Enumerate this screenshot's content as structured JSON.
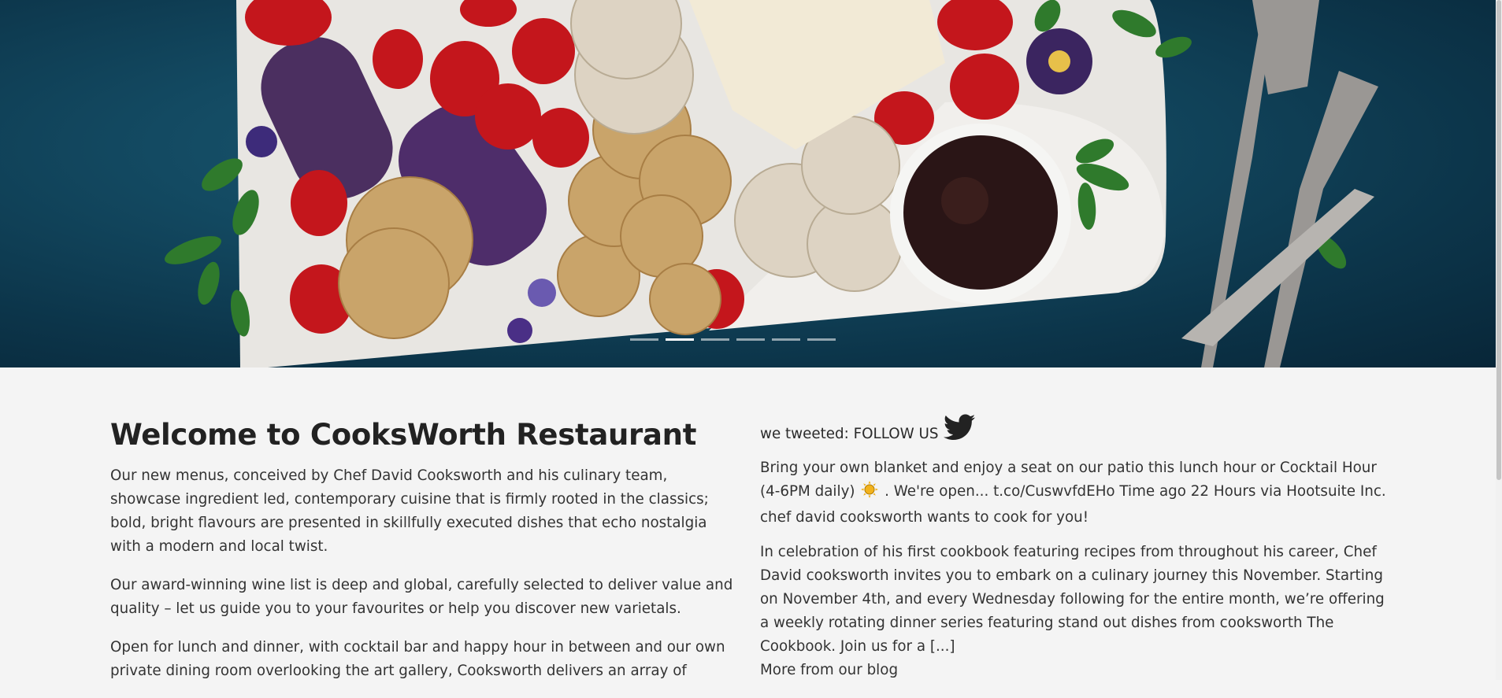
{
  "hero": {
    "slides_total": 6,
    "active_slide": 2
  },
  "welcome": {
    "title": "Welcome to CooksWorth Restaurant",
    "paragraphs": [
      "Our new menus, conceived by Chef David Cooksworth and his culinary team, showcase ingredient led, contemporary cuisine that is firmly rooted in the classics; bold, bright flavours are presented in skillfully executed dishes that echo nostalgia with a modern and local twist.",
      "Our award-winning wine list is deep and global, carefully selected to deliver value and quality – let us guide you to your favourites or help you discover new varietals.",
      "Open for lunch and dinner, with cocktail bar and happy hour in between and our own private dining room overlooking the art gallery, Cooksworth delivers an array of"
    ]
  },
  "social": {
    "heading": "we tweeted: FOLLOW US",
    "tweet_before_icon": "Bring your own blanket and enjoy a seat on our patio this lunch hour or Cocktail Hour (4-6PM daily)",
    "tweet_after_icon": ". We're open... t.co/CuswvfdEHo Time ago 22 Hours via Hootsuite Inc.",
    "tweet_sub": "chef david cooksworth wants to cook for you!",
    "blog_excerpt": "In celebration of his first cookbook featuring recipes from throughout his career, Chef David cooksworth invites you to embark on a culinary journey this November. Starting on November 4th, and every Wednesday following for the entire month, we’re offering a weekly rotating dinner series featuring stand out dishes from cooksworth The Cookbook. Join us for a [...]",
    "blog_link": "More from our blog"
  },
  "colors": {
    "page_bg": "#f4f4f4",
    "hero_bg": "#134a62",
    "text": "#333333",
    "twitter_icon": "#222222"
  }
}
